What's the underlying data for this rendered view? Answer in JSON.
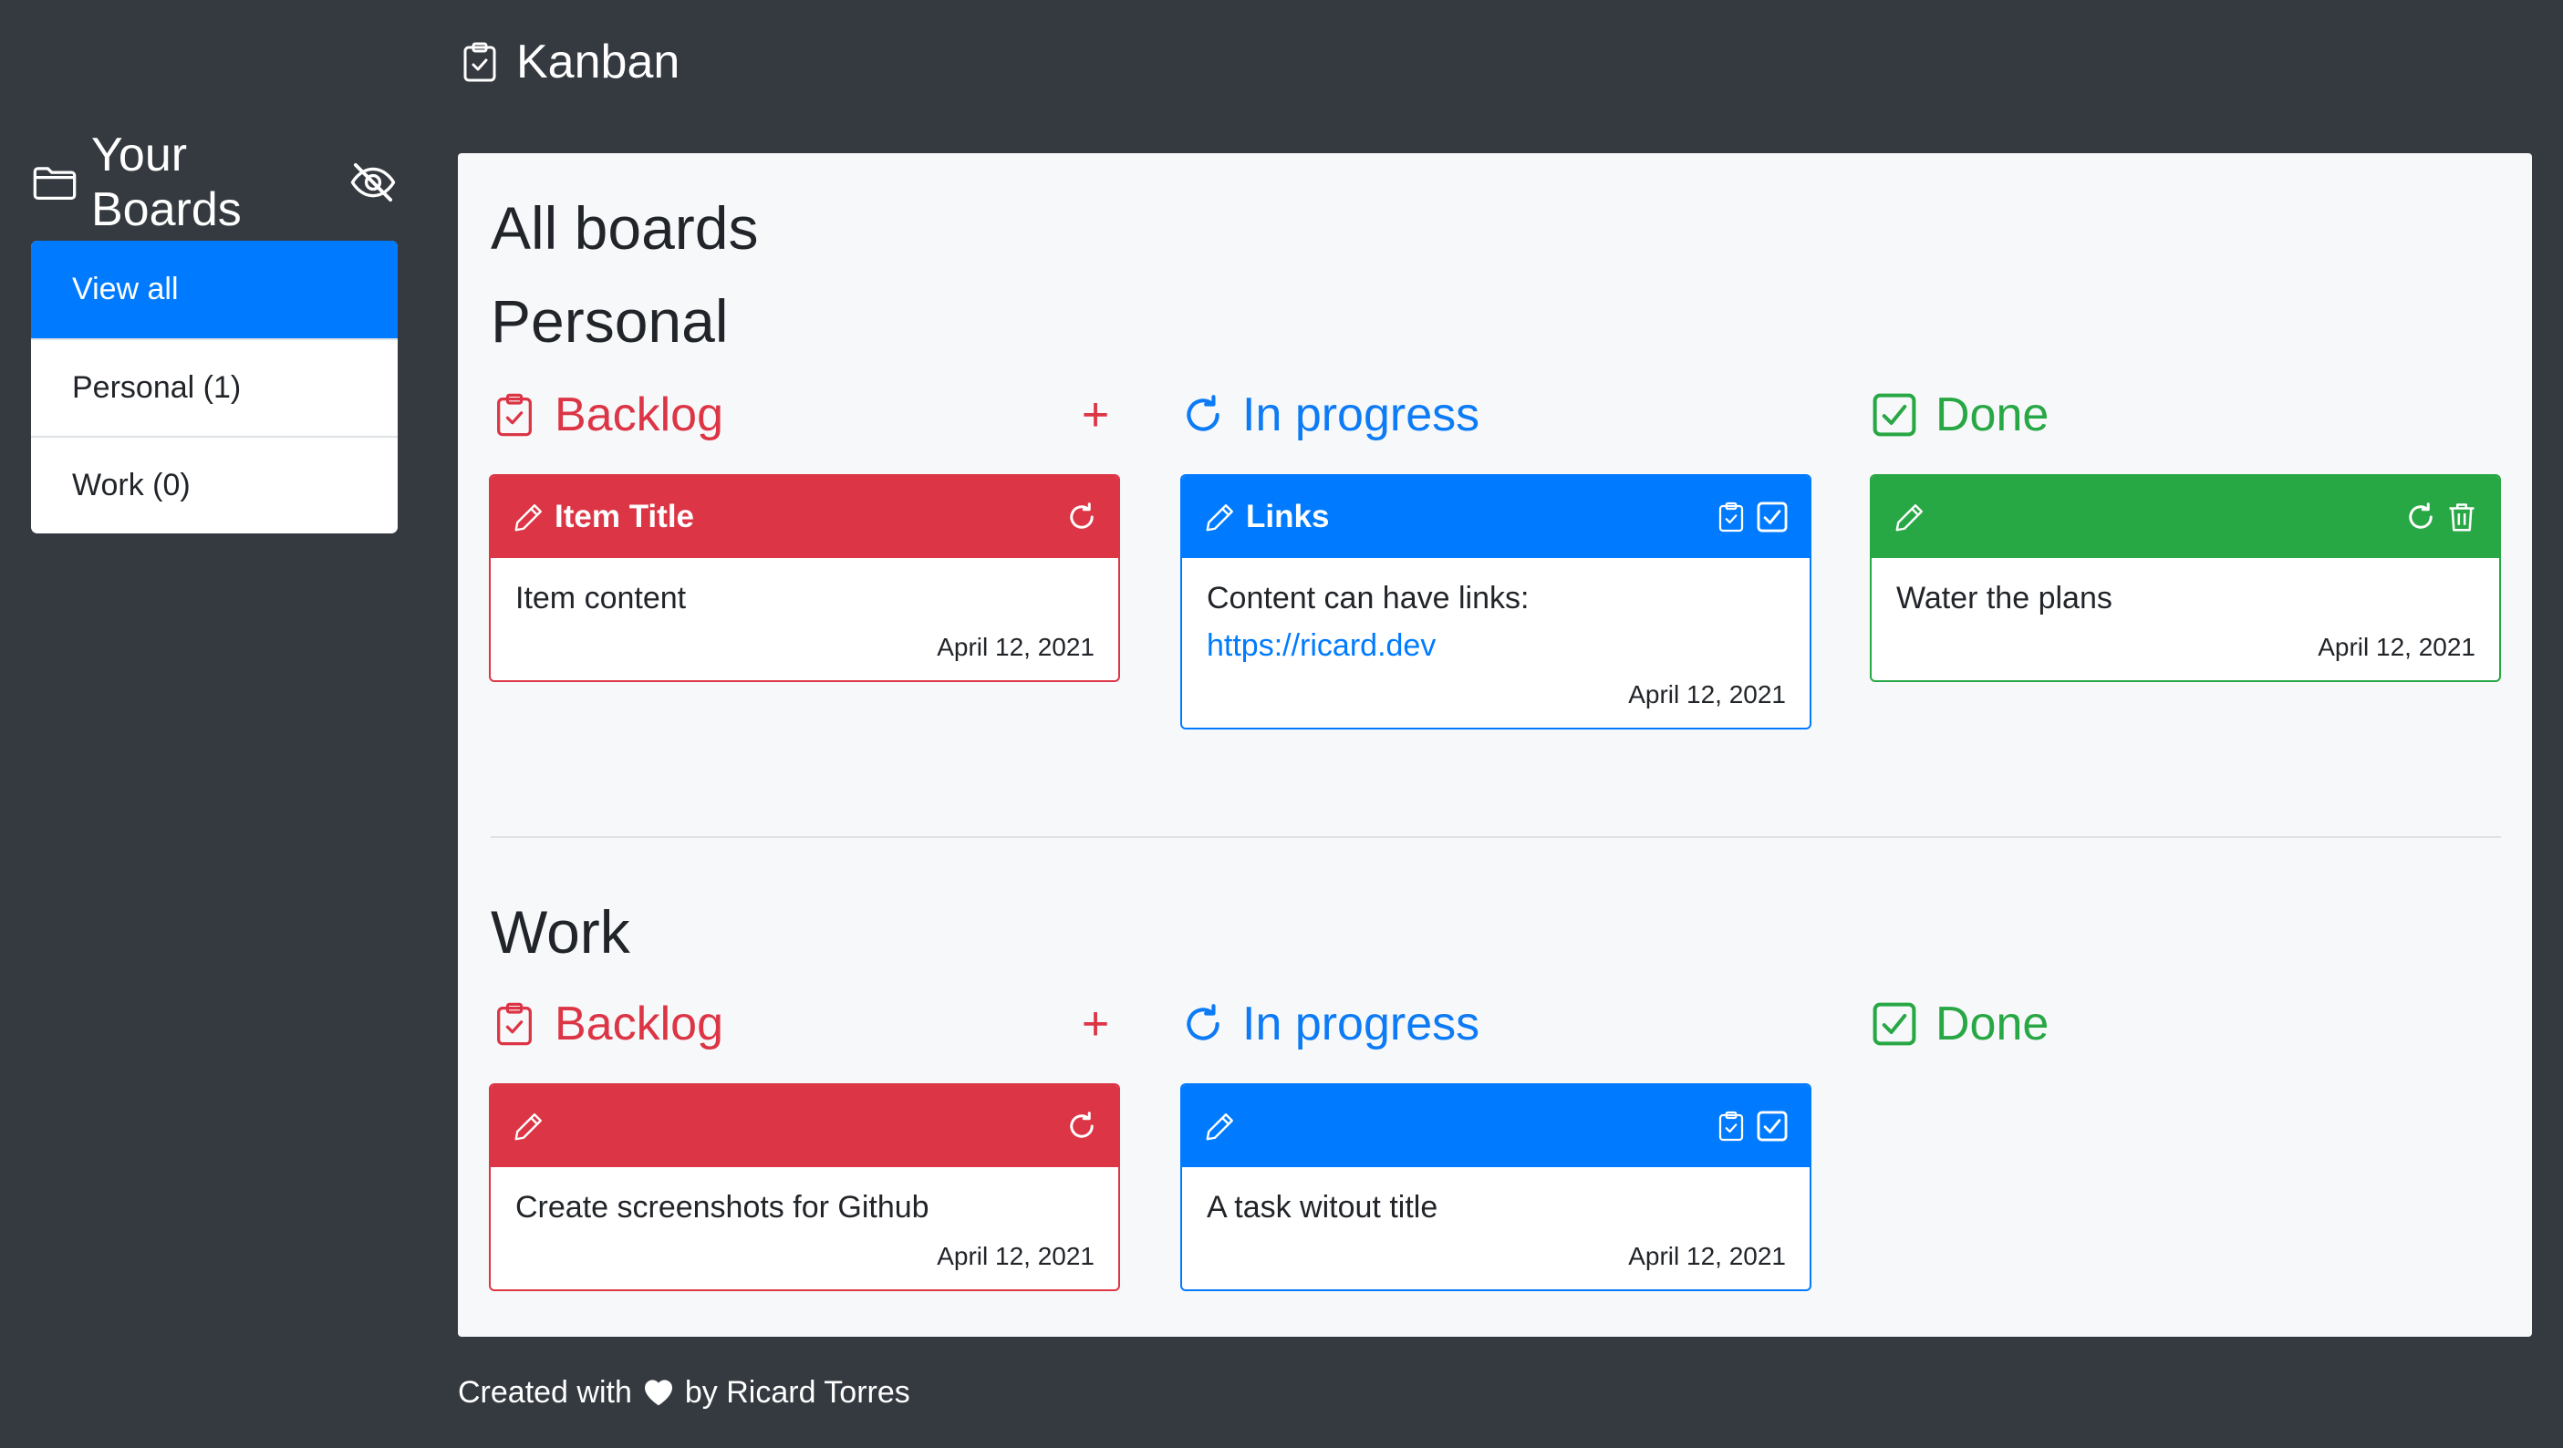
{
  "topbar": {
    "title": "Kanban",
    "icon": "clipboard-check-icon"
  },
  "sidebar": {
    "title": "Your Boards",
    "items": [
      {
        "label": "View all",
        "active": true
      },
      {
        "label": "Personal (1)"
      },
      {
        "label": "Work (0)"
      }
    ]
  },
  "main": {
    "title": "All boards",
    "boards": [
      {
        "name": "Personal",
        "columns": [
          {
            "label": "Backlog",
            "add": "+",
            "cards": [
              {
                "title": "Item Title",
                "content": "Item content",
                "date": "April 12, 2021"
              }
            ]
          },
          {
            "label": "In progress",
            "cards": [
              {
                "title": "Links",
                "content": "Content can have links:",
                "link": "https://ricard.dev",
                "date": "April 12, 2021"
              }
            ]
          },
          {
            "label": "Done",
            "cards": [
              {
                "title": "",
                "content": "Water the plans",
                "date": "April 12, 2021"
              }
            ]
          }
        ]
      },
      {
        "name": "Work",
        "columns": [
          {
            "label": "Backlog",
            "add": "+",
            "cards": [
              {
                "title": "",
                "content": "Create screenshots for Github",
                "date": "April 12, 2021"
              }
            ]
          },
          {
            "label": "In progress",
            "cards": [
              {
                "title": "",
                "content": "A task witout title",
                "date": "April 12, 2021"
              }
            ]
          },
          {
            "label": "Done",
            "cards": []
          }
        ]
      }
    ]
  },
  "footer": {
    "prefix": "Created with",
    "suffix": "by Ricard Torres",
    "icon": "heart-icon"
  },
  "colors": {
    "background": "#343a40",
    "primary": "#007bff",
    "danger": "#dc3545",
    "success": "#28a745",
    "panel": "#f7f8fa"
  }
}
